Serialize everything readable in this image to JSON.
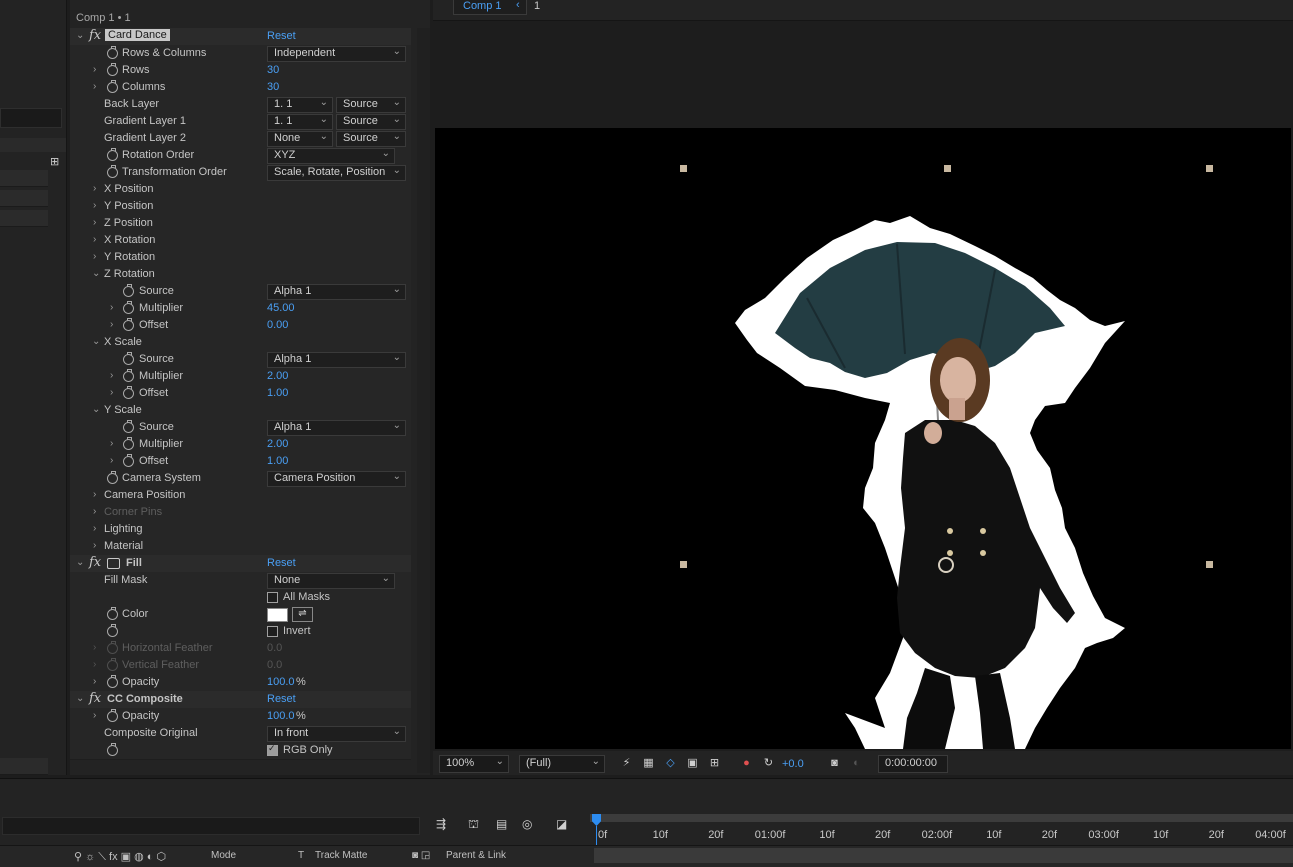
{
  "effect_controls": {
    "title": "Comp 1 • 1",
    "card_dance": {
      "name": "Card Dance",
      "reset": "Reset",
      "rows_columns": {
        "label": "Rows & Columns",
        "value": "Independent"
      },
      "rows": {
        "label": "Rows",
        "value": "30"
      },
      "columns": {
        "label": "Columns",
        "value": "30"
      },
      "back_layer": {
        "label": "Back Layer",
        "value": "1. 1",
        "source": "Source"
      },
      "gradient_layer_1": {
        "label": "Gradient Layer 1",
        "value": "1. 1",
        "source": "Source"
      },
      "gradient_layer_2": {
        "label": "Gradient Layer 2",
        "value": "None",
        "source": "Source"
      },
      "rotation_order": {
        "label": "Rotation Order",
        "value": "XYZ"
      },
      "transformation_order": {
        "label": "Transformation Order",
        "value": "Scale, Rotate, Position"
      },
      "x_position": "X Position",
      "y_position": "Y Position",
      "z_position": "Z Position",
      "x_rotation": "X Rotation",
      "y_rotation": "Y Rotation",
      "z_rotation": {
        "label": "Z Rotation",
        "source_label": "Source",
        "source": "Alpha 1",
        "multiplier_label": "Multiplier",
        "multiplier": "45.00",
        "offset_label": "Offset",
        "offset": "0.00"
      },
      "x_scale": {
        "label": "X Scale",
        "source_label": "Source",
        "source": "Alpha 1",
        "multiplier_label": "Multiplier",
        "multiplier": "2.00",
        "offset_label": "Offset",
        "offset": "1.00"
      },
      "y_scale": {
        "label": "Y Scale",
        "source_label": "Source",
        "source": "Alpha 1",
        "multiplier_label": "Multiplier",
        "multiplier": "2.00",
        "offset_label": "Offset",
        "offset": "1.00"
      },
      "camera_system": {
        "label": "Camera System",
        "value": "Camera Position"
      },
      "camera_position": "Camera Position",
      "corner_pins": "Corner Pins",
      "lighting": "Lighting",
      "material": "Material"
    },
    "fill": {
      "name": "Fill",
      "reset": "Reset",
      "fill_mask": {
        "label": "Fill Mask",
        "value": "None"
      },
      "all_masks": "All Masks",
      "color_label": "Color",
      "color_value": "#ffffff",
      "invert": "Invert",
      "horizontal_feather": {
        "label": "Horizontal Feather",
        "value": "0.0"
      },
      "vertical_feather": {
        "label": "Vertical Feather",
        "value": "0.0"
      },
      "opacity": {
        "label": "Opacity",
        "value": "100.0",
        "unit": "%"
      }
    },
    "cc_composite": {
      "name": "CC Composite",
      "reset": "Reset",
      "opacity": {
        "label": "Opacity",
        "value": "100.0",
        "unit": "%"
      },
      "composite_original": {
        "label": "Composite Original",
        "value": "In front"
      },
      "rgb_only": "RGB Only"
    }
  },
  "composition": {
    "tab": "Comp 1",
    "frame": "1",
    "zoom": "100%",
    "resolution": "(Full)",
    "exposure": "+0.0",
    "timecode": "0:00:00:00"
  },
  "timeline": {
    "ruler_labels": [
      "0f",
      "10f",
      "20f",
      "01:00f",
      "10f",
      "20f",
      "02:00f",
      "10f",
      "20f",
      "03:00f",
      "10f",
      "20f",
      "04:00f"
    ],
    "footer": {
      "mode": "Mode",
      "t": "T",
      "track_matte": "Track Matte",
      "parent_link": "Parent & Link"
    }
  },
  "colors": {
    "accent": "#4a9ff4",
    "panel": "#232323",
    "viewer_bg": "#000000"
  }
}
